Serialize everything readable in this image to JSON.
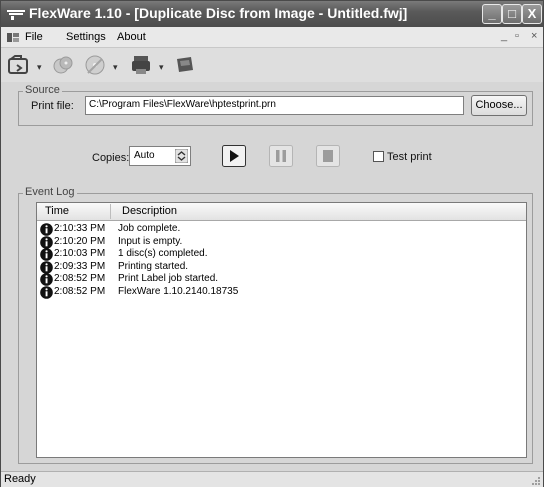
{
  "window": {
    "title": "FlexWare 1.10 - [Duplicate Disc from Image - Untitled.fwj]",
    "controls": {
      "minimize": "_",
      "maximize": "□",
      "close": "X"
    }
  },
  "menu": {
    "items": [
      "File",
      "Settings",
      "About"
    ],
    "mdi_controls": [
      "_",
      "▫",
      "×"
    ]
  },
  "toolbar": {
    "icons": [
      "open-folder-icon",
      "disc-copy-icon",
      "burn-disc-icon",
      "printer-icon",
      "save-icon"
    ]
  },
  "source": {
    "group_label": "Source",
    "print_file_label": "Print file:",
    "print_file_value": "C:\\Program Files\\FlexWare\\hptestprint.prn",
    "choose_button": "Choose..."
  },
  "controls": {
    "copies_label": "Copies:",
    "copies_value": "Auto",
    "test_print_label": "Test print"
  },
  "event_log": {
    "group_label": "Event Log",
    "columns": [
      "Time",
      "Description"
    ],
    "rows": [
      {
        "time": "2:10:33 PM",
        "description": "Job complete."
      },
      {
        "time": "2:10:20 PM",
        "description": "Input is empty."
      },
      {
        "time": "2:10:03 PM",
        "description": "1 disc(s) completed."
      },
      {
        "time": "2:09:33 PM",
        "description": "Printing started."
      },
      {
        "time": "2:08:52 PM",
        "description": "Print Label job started."
      },
      {
        "time": "2:08:52 PM",
        "description": "FlexWare 1.10.2140.18735"
      }
    ]
  },
  "status": {
    "text": "Ready"
  }
}
